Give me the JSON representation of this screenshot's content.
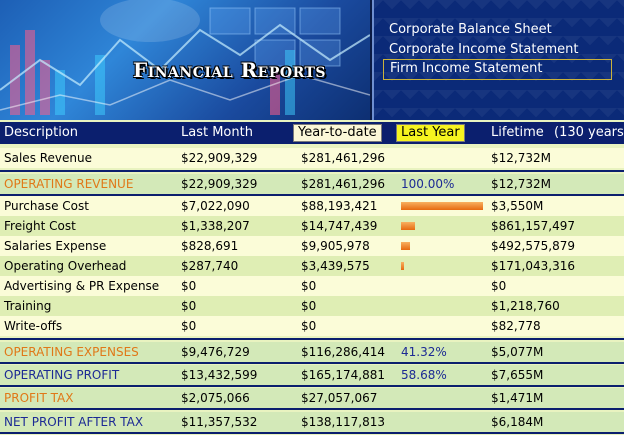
{
  "banner": {
    "title": "Financial Reports"
  },
  "report_menu": {
    "items": [
      {
        "label": "Corporate Balance Sheet",
        "selected": false
      },
      {
        "label": "Corporate Income Statement",
        "selected": false
      },
      {
        "label": "Firm Income Statement",
        "selected": true
      }
    ]
  },
  "columns": {
    "description": "Description",
    "last_month": "Last Month",
    "ytd": "Year-to-date",
    "last_year": "Last Year",
    "lifetime": "Lifetime",
    "lifetime_years": "(130 years)"
  },
  "rows": [
    {
      "label": "Sales Revenue",
      "last_month": "$22,909,329",
      "ytd": "$281,461,296",
      "last_year": "",
      "lifetime": "$12,732M"
    },
    {
      "label": "OPERATING REVENUE",
      "last_month": "$22,909,329",
      "ytd": "$281,461,296",
      "last_year": "100.00%",
      "lifetime": "$12,732M"
    },
    {
      "label": "Purchase Cost",
      "last_month": "$7,022,090",
      "ytd": "$88,193,421",
      "last_year": "",
      "lifetime": "$3,550M",
      "share": 0.313
    },
    {
      "label": "Freight Cost",
      "last_month": "$1,338,207",
      "ytd": "$14,747,439",
      "last_year": "",
      "lifetime": "$861,157,497",
      "share": 0.052
    },
    {
      "label": "Salaries Expense",
      "last_month": "$828,691",
      "ytd": "$9,905,978",
      "last_year": "",
      "lifetime": "$492,575,879",
      "share": 0.035
    },
    {
      "label": "Operating Overhead",
      "last_month": "$287,740",
      "ytd": "$3,439,575",
      "last_year": "",
      "lifetime": "$171,043,316",
      "share": 0.012
    },
    {
      "label": "Advertising & PR Expense",
      "last_month": "$0",
      "ytd": "$0",
      "last_year": "",
      "lifetime": "$0"
    },
    {
      "label": "Training",
      "last_month": "$0",
      "ytd": "$0",
      "last_year": "",
      "lifetime": "$1,218,760"
    },
    {
      "label": "Write-offs",
      "last_month": "$0",
      "ytd": "$0",
      "last_year": "",
      "lifetime": "$82,778"
    },
    {
      "label": "OPERATING EXPENSES",
      "last_month": "$9,476,729",
      "ytd": "$116,286,414",
      "last_year": "41.32%",
      "lifetime": "$5,077M"
    },
    {
      "label": "OPERATING PROFIT",
      "last_month": "$13,432,599",
      "ytd": "$165,174,881",
      "last_year": "58.68%",
      "lifetime": "$7,655M"
    },
    {
      "label": "PROFIT TAX",
      "last_month": "$2,075,066",
      "ytd": "$27,057,067",
      "last_year": "",
      "lifetime": "$1,471M"
    },
    {
      "label": "NET PROFIT AFTER TAX",
      "last_month": "$11,357,532",
      "ytd": "$138,117,813",
      "last_year": "",
      "lifetime": "$6,184M"
    }
  ],
  "colors": {
    "header_bg": "#0b1f6e",
    "orange_label": "#e07818",
    "blue_label": "#1c2a94",
    "bar": "#e66a10"
  }
}
